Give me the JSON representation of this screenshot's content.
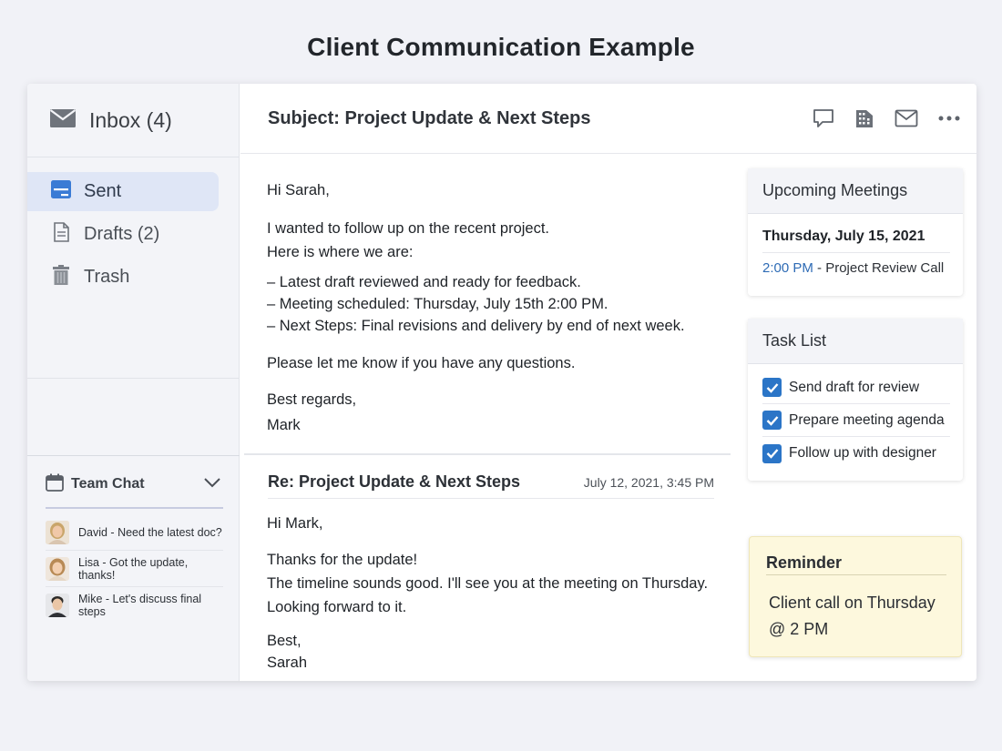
{
  "page_title": "Client Communication Example",
  "sidebar": {
    "inbox_label": "Inbox (4)",
    "folders": [
      {
        "label": "Sent",
        "icon": "sent-icon"
      },
      {
        "label": "Drafts (2)",
        "icon": "document-icon"
      },
      {
        "label": "Trash",
        "icon": "trash-icon"
      }
    ],
    "team_chat": {
      "title": "Team Chat",
      "messages": [
        {
          "name": "David",
          "text": "David - Need the latest doc?"
        },
        {
          "name": "Lisa",
          "text": "Lisa - Got the update, thanks!"
        },
        {
          "name": "Mike",
          "text": "Mike - Let's discuss final steps"
        }
      ]
    }
  },
  "email": {
    "subject": "Subject: Project Update & Next Steps",
    "greeting": "Hi Sarah,",
    "intro_1": "I wanted to follow up on the recent project.",
    "intro_2": "Here is where we are:",
    "bullets": [
      "–  Latest draft reviewed and ready for feedback.",
      "–  Meeting scheduled: Thursday, July 15th 2:00 PM.",
      "–  Next Steps: Final revisions and delivery by end of next week."
    ],
    "question": "Please let me know if you have any questions.",
    "closing": "Best regards,",
    "signature": "Mark"
  },
  "reply": {
    "subject": "Re: Project Update & Next Steps",
    "date": "July 12, 2021, 3:45 PM",
    "greeting": "Hi Mark,",
    "line_1": "Thanks for the update!",
    "line_2": "The timeline sounds good. I'll see you at the meeting on Thursday.",
    "line_3": "Looking forward to it.",
    "closing": "Best,",
    "signature": "Sarah"
  },
  "meetings": {
    "title": "Upcoming Meetings",
    "date": "Thursday, July 15, 2021",
    "time": "2:00 PM",
    "description": " - Project Review Call"
  },
  "tasks": {
    "title": "Task List",
    "items": [
      {
        "label": "Send draft for review",
        "checked": true
      },
      {
        "label": "Prepare meeting agenda",
        "checked": true
      },
      {
        "label": "Follow up with designer",
        "checked": true
      }
    ]
  },
  "reminder": {
    "title": "Reminder",
    "text_1": "Client call on Thursday",
    "text_2": "@ 2 PM"
  },
  "colors": {
    "accent_blue": "#2b75c7",
    "link_blue": "#2e6bb5",
    "reminder_bg": "#fdf8dd"
  }
}
